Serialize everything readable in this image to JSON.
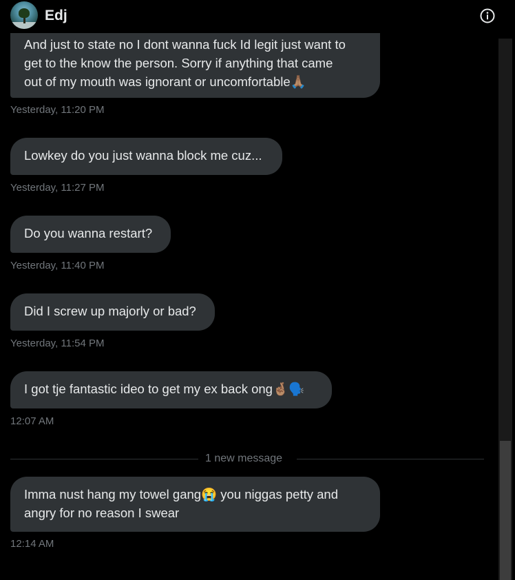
{
  "header": {
    "name": "Edj",
    "avatar_icon": "avatar-tree-photo",
    "info_icon": "info-icon"
  },
  "messages": [
    {
      "lines": [
        "And just to state no I dont wanna fuck Id legit just want to",
        "get to the know the person. Sorry if anything that came",
        "out of my mouth was ignorant or uncomfortable🙏🏽"
      ],
      "time": "Yesterday, 11:20 PM"
    },
    {
      "lines": [
        "Lowkey do you just wanna block me cuz..."
      ],
      "time": "Yesterday, 11:27 PM"
    },
    {
      "lines": [
        "Do you wanna restart?"
      ],
      "time": "Yesterday, 11:40 PM"
    },
    {
      "lines": [
        "Did I screw up majorly or bad?"
      ],
      "time": "Yesterday, 11:54 PM"
    },
    {
      "lines": [
        "I got tje fantastic ideo to get my ex back ong🤞🏽🗣️"
      ],
      "time": "12:07 AM"
    },
    {
      "lines": [
        "Imma nust hang my towel gang😭 you niggas petty and",
        "angry for no reason I swear"
      ],
      "time": "12:14 AM"
    }
  ],
  "divider": {
    "label": "1 new message"
  },
  "colors": {
    "background": "#000000",
    "bubble": "#2f3336",
    "timestamp": "#71767b",
    "text": "#e7e9ea"
  }
}
